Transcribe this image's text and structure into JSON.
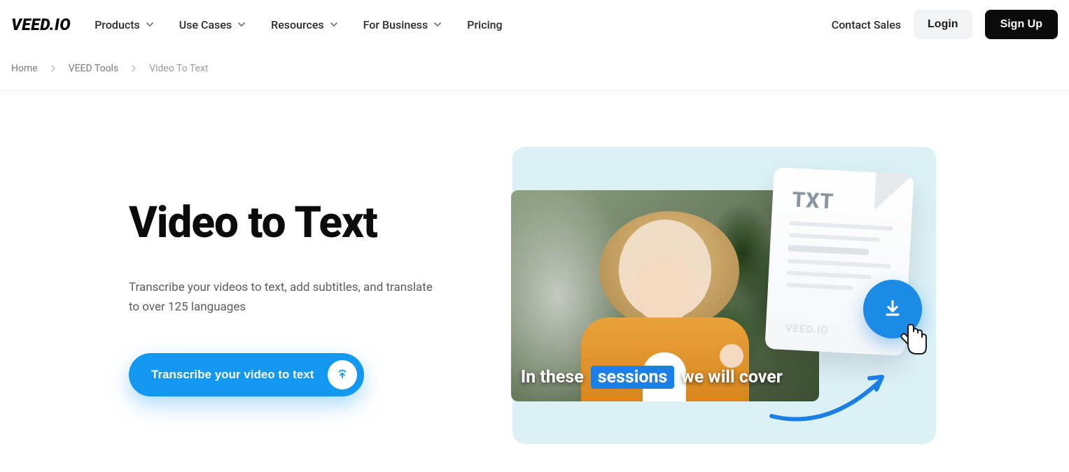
{
  "brand": "VEED.IO",
  "nav": {
    "items": [
      "Products",
      "Use Cases",
      "Resources",
      "For Business",
      "Pricing"
    ]
  },
  "header": {
    "contact": "Contact Sales",
    "login": "Login",
    "signup": "Sign Up"
  },
  "breadcrumb": {
    "items": [
      "Home",
      "VEED Tools",
      "Video To Text"
    ]
  },
  "hero": {
    "title": "Video to Text",
    "description": "Transcribe your videos to text, add subtitles, and translate to over 125 languages",
    "cta": "Transcribe your video to text"
  },
  "illustration": {
    "caption_before": "In these",
    "caption_highlight": "sessions",
    "caption_after": "we will cover",
    "doc_label": "TXT",
    "doc_brand": "VEED.IO"
  },
  "icons": {
    "play": "play-icon",
    "download": "download-icon",
    "upload": "upload-icon",
    "cursor": "cursor-icon",
    "chevron": "chevron-down-icon"
  },
  "colors": {
    "accent": "#1398f2",
    "illus_bg": "#dcf1f6",
    "doc_text": "#8b96a1"
  }
}
